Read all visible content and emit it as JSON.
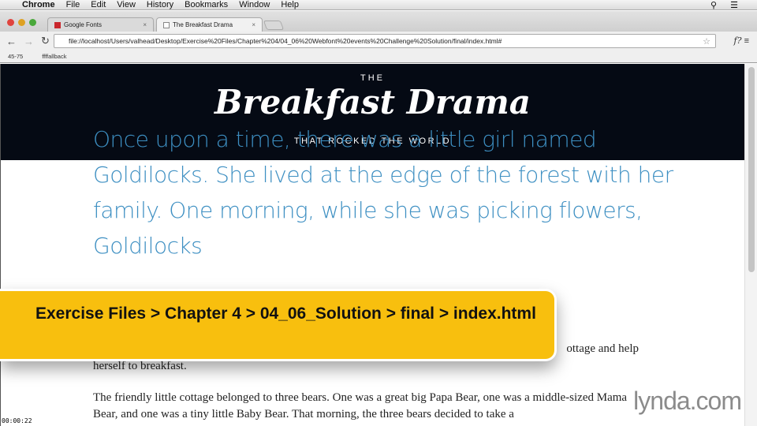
{
  "menubar": {
    "app": "Chrome",
    "items": [
      "File",
      "Edit",
      "View",
      "History",
      "Bookmarks",
      "Window",
      "Help"
    ]
  },
  "tabs": [
    {
      "label": "Google Fonts",
      "active": false
    },
    {
      "label": "The Breakfast Drama",
      "active": true
    }
  ],
  "toolbar": {
    "url": "file://localhost/Users/valhead/Desktop/Exercise%20Files/Chapter%204/04_06%20Webfont%20events%20Challenge%20Solution/final/index.html#",
    "font_ext": "f?"
  },
  "bookmarks": [
    "45-75",
    "ffffallback"
  ],
  "header": {
    "pre": "THE",
    "title": "Breakfast Drama",
    "subtitle": "THAT ROCKED THE WORLD"
  },
  "content": {
    "lead": "Once upon a time, there was a little girl named Goldilocks. She lived at the edge of the forest with her family. One morning, while she was picking flowers, Goldilocks",
    "para1_visible_end": "ottage and help",
    "para1_line2": "herself to breakfast.",
    "para2": "The friendly little cottage belonged to three bears. One was a great big Papa Bear, one was a middle-sized Mama Bear, and one was a tiny little Baby Bear. That morning, the three bears decided to take a"
  },
  "overlay": {
    "path": "Exercise Files > Chapter 4 > 04_06_Solution > final > index.html"
  },
  "watermark": "lynda.com",
  "timestamp": "00:00:22",
  "colors": {
    "accent": "#3d8fc2",
    "header_bg": "#050a14",
    "overlay": "#f8bf0e"
  }
}
